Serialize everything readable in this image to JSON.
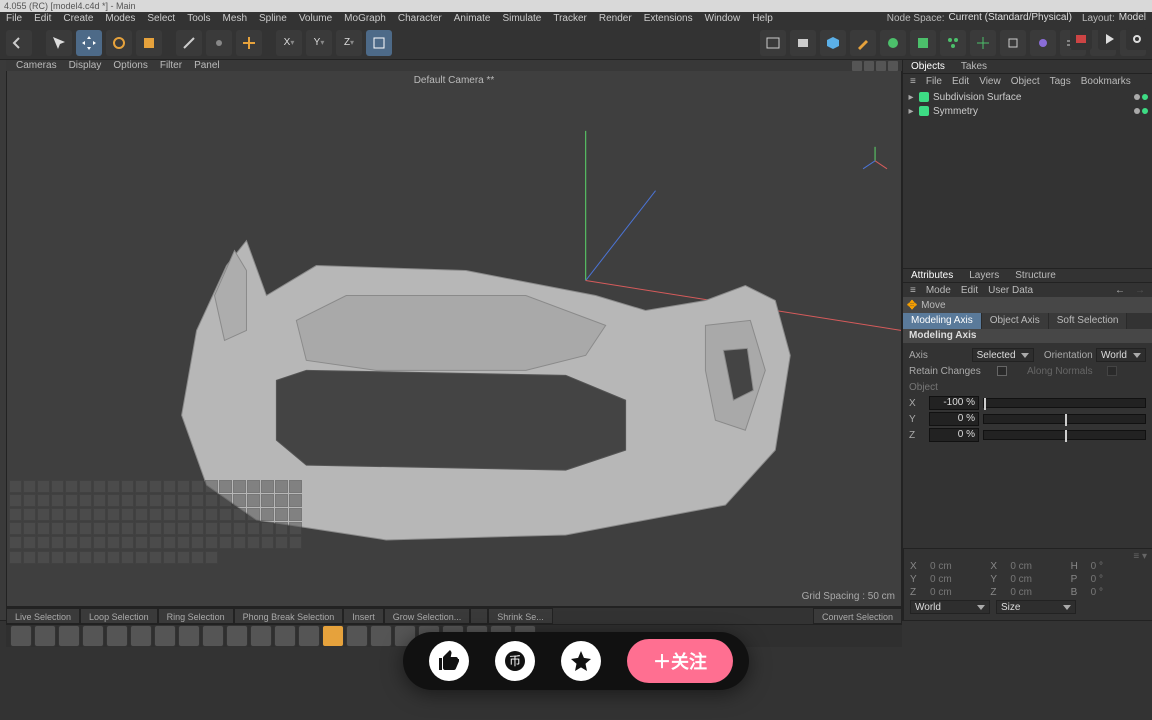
{
  "title": "4.055 (RC) [model4.c4d *] - Main",
  "menu": [
    "File",
    "Edit",
    "Create",
    "Modes",
    "Select",
    "Tools",
    "Mesh",
    "Spline",
    "Volume",
    "MoGraph",
    "Character",
    "Animate",
    "Simulate",
    "Tracker",
    "Render",
    "Extensions",
    "Window",
    "Help"
  ],
  "top_right": {
    "node_space_label": "Node Space:",
    "node_space": "Current (Standard/Physical)",
    "layout_label": "Layout:",
    "layout": "Model"
  },
  "viewport": {
    "menus": [
      "Cameras",
      "Display",
      "Options",
      "Filter",
      "Panel"
    ],
    "camera": "Default Camera **",
    "grid_spacing": "Grid Spacing : 50 cm"
  },
  "objects_panel": {
    "tabs": [
      "Objects",
      "Takes"
    ],
    "menus": [
      "File",
      "Edit",
      "View",
      "Object",
      "Tags",
      "Bookmarks"
    ],
    "tree": [
      {
        "name": "Subdivision Surface",
        "icon_color": "#3ddc84"
      },
      {
        "name": "Symmetry",
        "icon_color": "#3ddc84"
      }
    ]
  },
  "attr_panel": {
    "tabs": [
      "Attributes",
      "Layers",
      "Structure"
    ],
    "menus": [
      "Mode",
      "Edit",
      "User Data"
    ],
    "tool_name": "Move",
    "sub_tabs": [
      "Modeling Axis",
      "Object Axis",
      "Soft Selection"
    ],
    "section": "Modeling Axis",
    "axis_label": "Axis",
    "axis_value": "Selected",
    "orient_label": "Orientation",
    "orient_value": "World",
    "retain_label": "Retain Changes",
    "along_label": "Along Normals",
    "object_label": "Object",
    "rows": [
      {
        "axis": "X",
        "val": "-100 %",
        "knob": 0
      },
      {
        "axis": "Y",
        "val": "0 %",
        "knob": 0.5
      },
      {
        "axis": "Z",
        "val": "0 %",
        "knob": 0.5
      }
    ]
  },
  "bottom_tabs": [
    "Live Selection",
    "Loop Selection",
    "Ring Selection",
    "Phong Break Selection",
    "Insert",
    "Grow Selection...",
    "",
    "Shrink Se...",
    "",
    "",
    "",
    "Convert Selection"
  ],
  "coord": {
    "rows": [
      {
        "l1": "X",
        "v1": "0 cm",
        "l2": "X",
        "v2": "0 cm",
        "l3": "H",
        "v3": "0 °"
      },
      {
        "l1": "Y",
        "v1": "0 cm",
        "l2": "Y",
        "v2": "0 cm",
        "l3": "P",
        "v3": "0 °"
      },
      {
        "l1": "Z",
        "v1": "0 cm",
        "l2": "Z",
        "v2": "0 cm",
        "l3": "B",
        "v3": "0 °"
      }
    ],
    "drops": [
      "World",
      "Size"
    ]
  },
  "overlay_button": "＋关注"
}
